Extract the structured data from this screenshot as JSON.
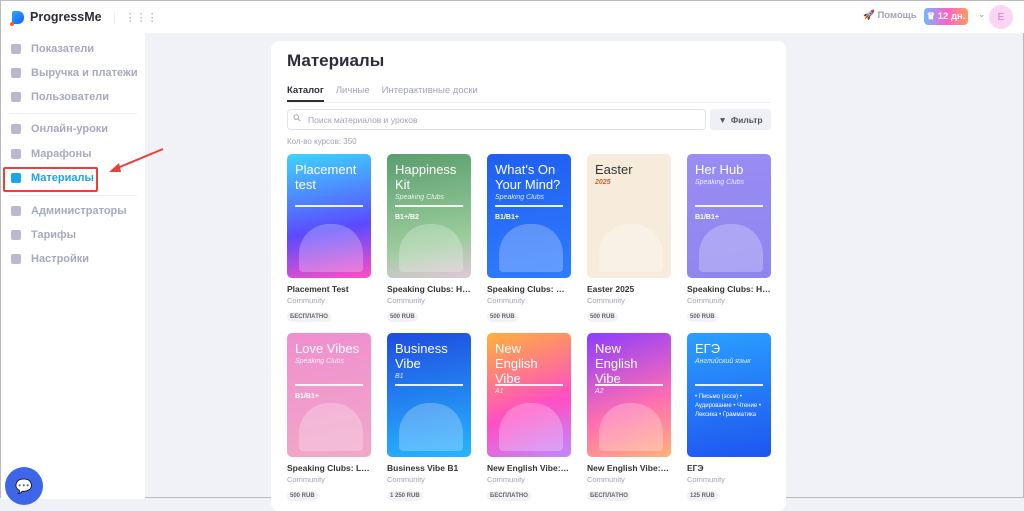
{
  "header": {
    "logo": "ProgressMe",
    "help": "Помощь",
    "trial": "♛ 12 дн.",
    "avatar": "E"
  },
  "sidebar": {
    "items": [
      "Показатели",
      "Выручка и платежи",
      "Пользователи",
      "Онлайн-уроки",
      "Марафоны",
      "Материалы",
      "Администраторы",
      "Тарифы",
      "Настройки"
    ],
    "active": "Материалы"
  },
  "main": {
    "title": "Материалы",
    "tabs": [
      "Каталог",
      "Личные",
      "Интерактивные доски"
    ],
    "search_placeholder": "Поиск материалов и уроков",
    "filter": "Фильтр",
    "count": "Кол-во курсов: 350",
    "cards": [
      {
        "cover_title": "Placement test",
        "cover_sub": "",
        "level": "",
        "title": "Placement Test",
        "author": "Community",
        "price": "БЕСПЛАТНО",
        "bg": "linear-gradient(170deg,#3fd4ff,#5a4bff 60%,#ff4fc4)"
      },
      {
        "cover_title": "Happiness Kit",
        "cover_sub": "Speaking Clubs",
        "level": "B1+/B2",
        "title": "Speaking Clubs: Hap...",
        "author": "Community",
        "price": "500 RUB",
        "bg": "linear-gradient(170deg,#5a9e6e,#9ccc9c 70%,#e0c8d8)"
      },
      {
        "cover_title": "What's On Your Mind?",
        "cover_sub": "Speaking Clubs",
        "level": "B1/B1+",
        "title": "Speaking Clubs: Wh...",
        "author": "Community",
        "price": "500 RUB",
        "bg": "linear-gradient(170deg,#1f5ff0,#2f7cff)"
      },
      {
        "cover_title": "Easter",
        "cover_sub": "2025",
        "level": "",
        "title": "Easter 2025",
        "author": "Community",
        "price": "500 RUB",
        "bg": "#f7ecdc"
      },
      {
        "cover_title": "Her Hub",
        "cover_sub": "Speaking Clubs",
        "level": "B1/B1+",
        "title": "Speaking Clubs: Her...",
        "author": "Community",
        "price": "500 RUB",
        "bg": "linear-gradient(170deg,#9a8cf2,#8e86f0)"
      },
      {
        "cover_title": "Love Vibes",
        "cover_sub": "Speaking Clubs",
        "level": "B1/B1+",
        "title": "Speaking Clubs: Lov...",
        "author": "Community",
        "price": "500 RUB",
        "bg": "linear-gradient(170deg,#f08ed0,#f0a8c8)"
      },
      {
        "cover_title": "Business Vibe",
        "cover_sub": "B1",
        "level": "",
        "title": "Business Vibe B1",
        "author": "Community",
        "price": "1 250 RUB",
        "bg": "linear-gradient(170deg,#1f4ce0,#27b5ff)"
      },
      {
        "cover_title": "New English Vibe",
        "cover_sub": "A1",
        "level": "",
        "title": "New English Vibe: A1",
        "author": "Community",
        "price": "БЕСПЛАТНО",
        "bg": "linear-gradient(160deg,#ffb13a,#ff4fc4 60%,#c08aff)"
      },
      {
        "cover_title": "New English Vibe",
        "cover_sub": "A2",
        "level": "",
        "title": "New English Vibe: A2",
        "author": "Community",
        "price": "БЕСПЛАТНО",
        "bg": "linear-gradient(160deg,#8c3cff,#ff6fb0 60%,#ffb27a)"
      },
      {
        "cover_title": "ЕГЭ",
        "cover_sub": "Английский язык",
        "level": "• Письмо (эссе) • Аудирование • Чтение • Лексика • Грамматика",
        "title": "ЕГЭ",
        "author": "Community",
        "price": "125 RUB",
        "bg": "linear-gradient(170deg,#2aa0ff,#1f55f0)"
      }
    ]
  }
}
